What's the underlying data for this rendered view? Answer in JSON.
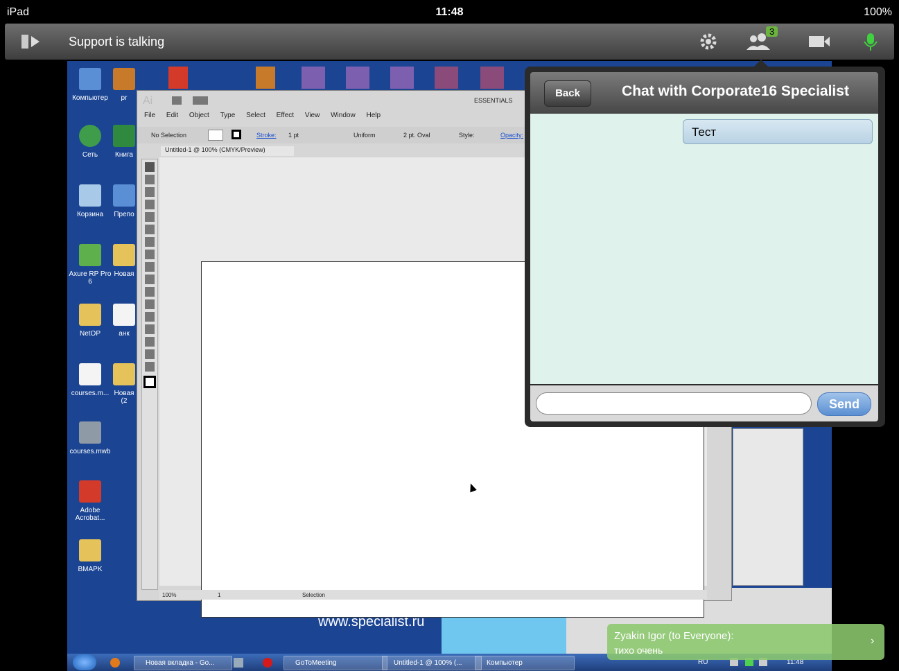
{
  "status_bar": {
    "device": "iPad",
    "time": "11:48",
    "battery": "100%"
  },
  "toolbar": {
    "status_text": "Support is talking",
    "attendee_count": "3"
  },
  "desktop": {
    "icons": [
      {
        "label": "Компьютер"
      },
      {
        "label": "Сеть"
      },
      {
        "label": "Корзина"
      },
      {
        "label": "Axure RP Pro 6"
      },
      {
        "label": "NetOP"
      },
      {
        "label": "courses.m..."
      },
      {
        "label": "courses.mwb"
      },
      {
        "label": "Adobe Acrobat..."
      },
      {
        "label": "BMAPK"
      }
    ],
    "icons_col2": [
      {
        "label": "pr"
      },
      {
        "label": "Книга"
      },
      {
        "label": "Препо"
      },
      {
        "label": "Новая"
      },
      {
        "label": "анк"
      },
      {
        "label": "Новая (2"
      }
    ],
    "banner_url": "www.specialist.ru"
  },
  "illustrator": {
    "workspace": "ESSENTIALS",
    "menu": [
      "File",
      "Edit",
      "Object",
      "Type",
      "Select",
      "Effect",
      "View",
      "Window",
      "Help"
    ],
    "control": {
      "selection": "No Selection",
      "stroke_label": "Stroke:",
      "stroke_value": "1 pt",
      "profile": "Uniform",
      "brush": "2 pt. Oval",
      "style_label": "Style:",
      "opacity_label": "Opacity:"
    },
    "doc_tab": "Untitled-1 @ 100% (CMYK/Preview)",
    "zoom": "100%",
    "page": "1",
    "tool_status": "Selection"
  },
  "chat": {
    "back_label": "Back",
    "title": "Chat with Corporate16 Specialist",
    "messages": [
      "Тест"
    ],
    "input_placeholder": "",
    "send_label": "Send"
  },
  "taskbar": {
    "items": [
      "Новая вкладка - Go...",
      "GoToMeeting",
      "Untitled-1 @ 100% (...",
      "Компьютер"
    ],
    "lang": "RU",
    "clock": "11:48"
  },
  "notification": {
    "sender": "Zyakin Igor (to Everyone):",
    "text": "тихо очень"
  }
}
